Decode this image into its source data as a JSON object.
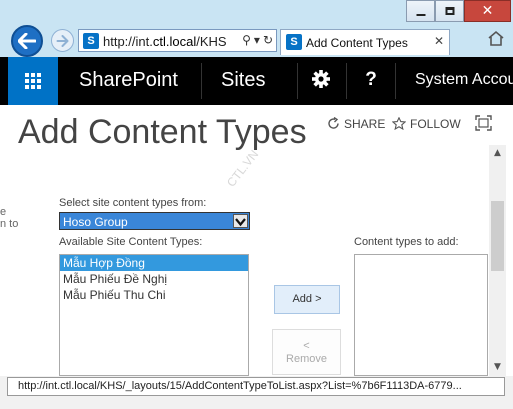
{
  "window": {
    "close_glyph": "✕"
  },
  "address_bar": {
    "url_prefix": "http://int.",
    "url_domain": "ctl.local",
    "url_suffix": "/KHS",
    "search_glyph": "⚲",
    "dropdown_glyph": "▾",
    "refresh_glyph": "↻",
    "favicon_text": "S"
  },
  "tab": {
    "title": "Add Content Types",
    "close_glyph": "✕"
  },
  "suite_bar": {
    "brand": "SharePoint",
    "sites": "Sites",
    "help_glyph": "?",
    "account": "System Accou",
    "accent_color": "#0072c6"
  },
  "page": {
    "title": "Add Content Types",
    "share": "SHARE",
    "follow": "FOLLOW",
    "left_fragment": [
      "e",
      "n to"
    ],
    "select_label": "Select site content types from:",
    "selected_group": "Hoso Group",
    "watermark": "CTL.VN",
    "available_label": "Available Site Content Types:",
    "available_items": [
      "Mẫu Hợp Đồng",
      "Mẫu Phiếu Đề Nghị",
      "Mẫu Phiếu Thu Chi"
    ],
    "add_label": "Content types to add:",
    "add_button": "Add >",
    "remove_button_arrow": "<",
    "remove_button": "Remove"
  },
  "status_bar": {
    "url": "http://int.ctl.local/KHS/_layouts/15/AddContentTypeToList.aspx?List=%7b6F1113DA-6779..."
  }
}
